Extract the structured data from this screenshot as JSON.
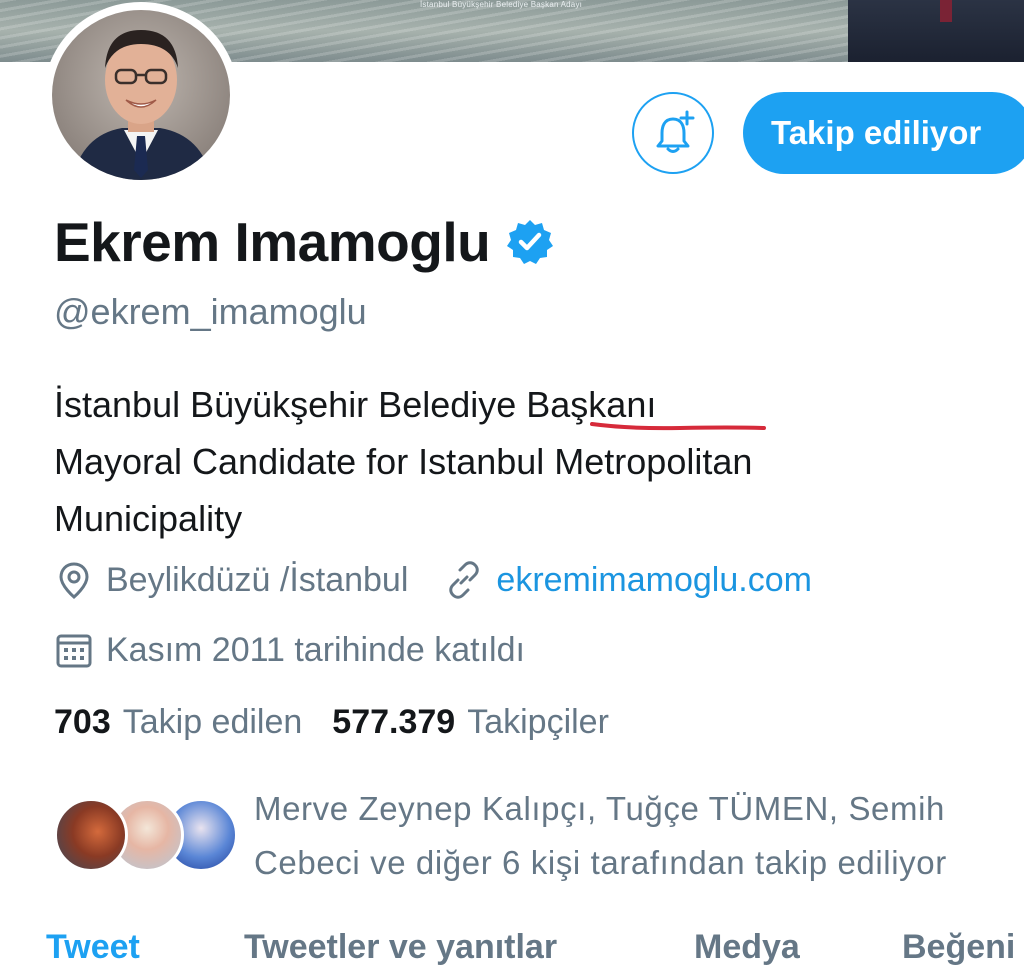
{
  "banner": {
    "caption": "İstanbul Büyükşehir Belediye Başkan Adayı"
  },
  "profile": {
    "display_name": "Ekrem Imamoglu",
    "handle": "@ekrem_imamoglu",
    "verified_icon": "verified-badge-icon",
    "bio_lines": [
      "İstanbul Büyükşehir Belediye Başkanı",
      "Mayoral Candidate for Istanbul Metropolitan",
      "Municipality"
    ],
    "location": "Beylikdüzü /İstanbul",
    "website": "ekremimamoglu.com",
    "joined": "Kasım 2011 tarihinde katıldı"
  },
  "actions": {
    "notifications_icon": "bell-plus-icon",
    "follow_label": "Takip ediliyor"
  },
  "stats": {
    "following_count": "703",
    "following_label": "Takip edilen",
    "followers_count": "577.379",
    "followers_label": "Takipçiler"
  },
  "followed_by": {
    "line1": "Merve Zeynep Kalıpçı, Tuğçe TÜMEN, Semih",
    "line2": "Cebeci ve diğer 6 kişi tarafından takip ediliyor"
  },
  "tabs": [
    {
      "label": "Tweet"
    },
    {
      "label": "Tweetler ve yanıtlar"
    },
    {
      "label": "Medya"
    },
    {
      "label": "Beğeni"
    }
  ],
  "colors": {
    "accent": "#1da1f2",
    "secondary_text": "#657786",
    "primary_text": "#14171a",
    "annotation_underline": "#d62a3a"
  }
}
